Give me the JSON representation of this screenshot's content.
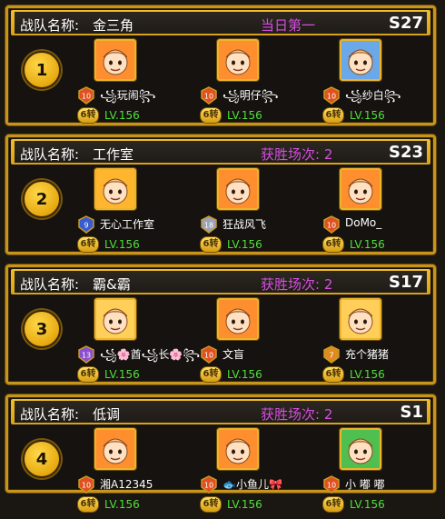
{
  "teams": [
    {
      "label": "战队名称:",
      "name": "金三角",
      "status": "当日第一",
      "season": "S27",
      "rank": "1",
      "members": [
        {
          "name": "꧁玩闹꧂",
          "emblem": "10",
          "emblem_color": "#e05020",
          "turn": "6转",
          "level": "LV.156",
          "avatar_bg": "#ff8f2e"
        },
        {
          "name": "꧁明仔꧂",
          "emblem": "10",
          "emblem_color": "#e05020",
          "turn": "6转",
          "level": "LV.156",
          "avatar_bg": "#ff8f2e"
        },
        {
          "name": "꧁纱白꧂",
          "emblem": "10",
          "emblem_color": "#e05020",
          "turn": "6转",
          "level": "LV.156",
          "avatar_bg": "#6aa8e8"
        }
      ]
    },
    {
      "label": "战队名称:",
      "name": "工作室",
      "status": "获胜场次: 2",
      "season": "S23",
      "rank": "2",
      "members": [
        {
          "name": "无心工作室",
          "emblem": "9",
          "emblem_color": "#3a5bd0",
          "turn": "6转",
          "level": "LV.156",
          "avatar_bg": "#ffb52e"
        },
        {
          "name": "狂战风飞",
          "emblem": "18",
          "emblem_color": "#9aa3b8",
          "turn": "6转",
          "level": "LV.156",
          "avatar_bg": "#ff8f2e"
        },
        {
          "name": "DoMo_",
          "emblem": "10",
          "emblem_color": "#e05020",
          "turn": "6转",
          "level": "LV.156",
          "avatar_bg": "#ff8f2e"
        }
      ]
    },
    {
      "label": "战队名称:",
      "name": "霸&霸",
      "status": "获胜场次: 2",
      "season": "S17",
      "rank": "3",
      "members": [
        {
          "name": "꧁🌸酋꧁长🌸꧂",
          "emblem": "13",
          "emblem_color": "#8a4fd0",
          "turn": "6转",
          "level": "LV.156",
          "avatar_bg": "#ffcf5a"
        },
        {
          "name": "文盲",
          "emblem": "10",
          "emblem_color": "#e05020",
          "turn": "6转",
          "level": "LV.156",
          "avatar_bg": "#ff8f2e"
        },
        {
          "name": "充个猪猪",
          "emblem": "7",
          "emblem_color": "#e08a20",
          "turn": "6转",
          "level": "LV.156",
          "avatar_bg": "#ffcf5a"
        }
      ]
    },
    {
      "label": "战队名称:",
      "name": "低调",
      "status": "获胜场次: 2",
      "season": "S1",
      "rank": "4",
      "members": [
        {
          "name": "湘A12345",
          "emblem": "10",
          "emblem_color": "#e05020",
          "turn": "6转",
          "level": "LV.156",
          "avatar_bg": "#ff8f2e"
        },
        {
          "name": "🐟小鱼儿🎀",
          "emblem": "10",
          "emblem_color": "#e05020",
          "turn": "6转",
          "level": "LV.156",
          "avatar_bg": "#ff8f2e"
        },
        {
          "name": "小 嘟 嘟",
          "emblem": "10",
          "emblem_color": "#e05020",
          "turn": "6转",
          "level": "LV.156",
          "avatar_bg": "#4fbf4f"
        }
      ]
    }
  ]
}
